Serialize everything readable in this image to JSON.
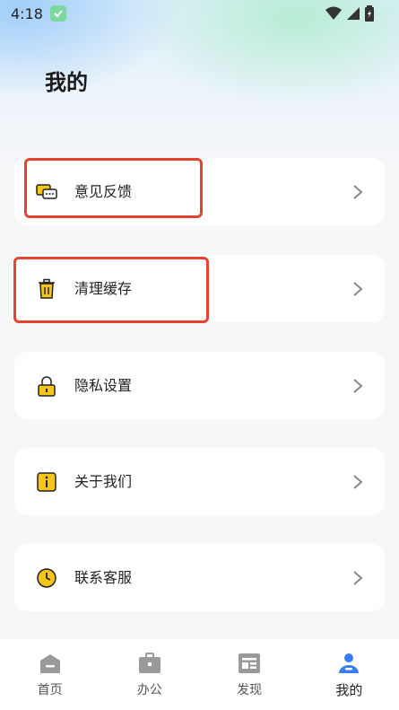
{
  "status_bar": {
    "time": "4:18"
  },
  "header": {
    "title": "我的"
  },
  "menu": [
    {
      "label": "意见反馈",
      "icon": "chat-bubbles-icon"
    },
    {
      "label": "清理缓存",
      "icon": "trash-can-icon"
    },
    {
      "label": "隐私设置",
      "icon": "lock-icon"
    },
    {
      "label": "关于我们",
      "icon": "info-icon"
    },
    {
      "label": "联系客服",
      "icon": "clock-icon"
    }
  ],
  "tabbar": [
    {
      "label": "首页",
      "icon": "home-icon",
      "active": false
    },
    {
      "label": "办公",
      "icon": "briefcase-icon",
      "active": false
    },
    {
      "label": "发现",
      "icon": "news-icon",
      "active": false
    },
    {
      "label": "我的",
      "icon": "user-icon",
      "active": true
    }
  ],
  "colors": {
    "accent": "#3b7cf0",
    "icon_yellow": "#f5c518",
    "highlight_red": "#e2442f",
    "inactive_icon": "#9a9a9a"
  }
}
